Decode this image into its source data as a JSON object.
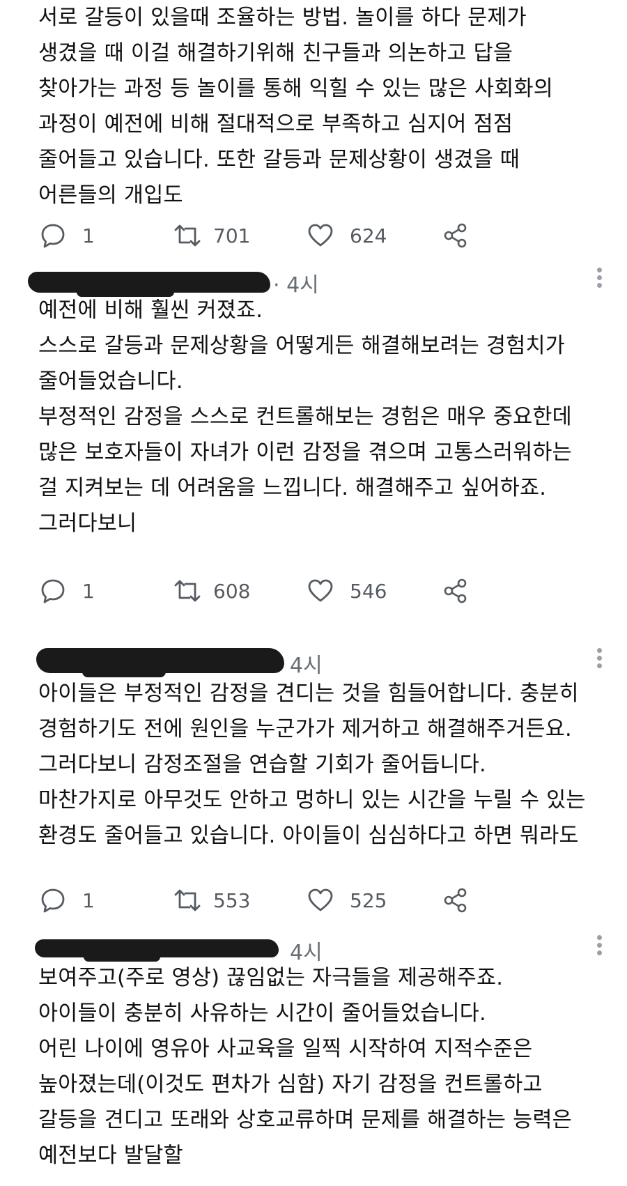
{
  "tweets": [
    {
      "time": "",
      "lines": [
        "서로 갈등이 있을때 조율하는 방법. 놀이를 하다 문제가",
        "생겼을 때 이걸 해결하기위해 친구들과 의논하고 답을",
        "찾아가는 과정 등 놀이를 통해 익힐 수 있는 많은 사회화의",
        "과정이 예전에 비해 절대적으로 부족하고 심지어 점점",
        "줄어들고 있습니다. 또한 갈등과 문제상황이 생겼을 때",
        "어른들의 개입도"
      ],
      "replies": "1",
      "retweets": "701",
      "likes": "624"
    },
    {
      "time": "· 4시",
      "lines": [
        "예전에 비해 훨씬 커졌죠.",
        "스스로 갈등과 문제상황을 어떻게든 해결해보려는 경험치가",
        "줄어들었습니다.",
        "부정적인 감정을 스스로 컨트롤해보는 경험은 매우 중요한데",
        "많은 보호자들이 자녀가 이런 감정을 겪으며 고통스러워하는",
        "걸 지켜보는 데 어려움을 느낍니다. 해결해주고 싶어하죠.",
        "그러다보니"
      ],
      "replies": "1",
      "retweets": "608",
      "likes": "546"
    },
    {
      "time": "4시",
      "lines": [
        "아이들은 부정적인 감정을 견디는 것을 힘들어합니다. 충분히",
        "경험하기도 전에 원인을 누군가가 제거하고 해결해주거든요.",
        "그러다보니 감정조절을 연습할 기회가 줄어듭니다.",
        "마찬가지로 아무것도 안하고 멍하니 있는 시간을 누릴 수 있는",
        "환경도 줄어들고 있습니다. 아이들이 심심하다고 하면 뭐라도"
      ],
      "replies": "1",
      "retweets": "553",
      "likes": "525"
    },
    {
      "time": "4시",
      "lines": [
        "보여주고(주로 영상) 끊임없는 자극들을 제공해주죠.",
        "아이들이 충분히 사유하는 시간이 줄어들었습니다.",
        "어린 나이에 영유아 사교육을 일찍 시작하여 지적수준은",
        "높아졌는데(이것도 편차가 심함) 자기 감정을 컨트롤하고",
        "갈등을 견디고 또래와 상호교류하며 문제를 해결하는 능력은",
        "예전보다 발달할"
      ]
    }
  ],
  "icons": {
    "reply": "reply-bubble-icon",
    "retweet": "retweet-icon",
    "like": "heart-icon",
    "share": "share-icon",
    "more": "more-vertical-icon"
  },
  "colors": {
    "text": "#111111",
    "muted": "#555b61",
    "redaction": "#1a1a1a"
  }
}
